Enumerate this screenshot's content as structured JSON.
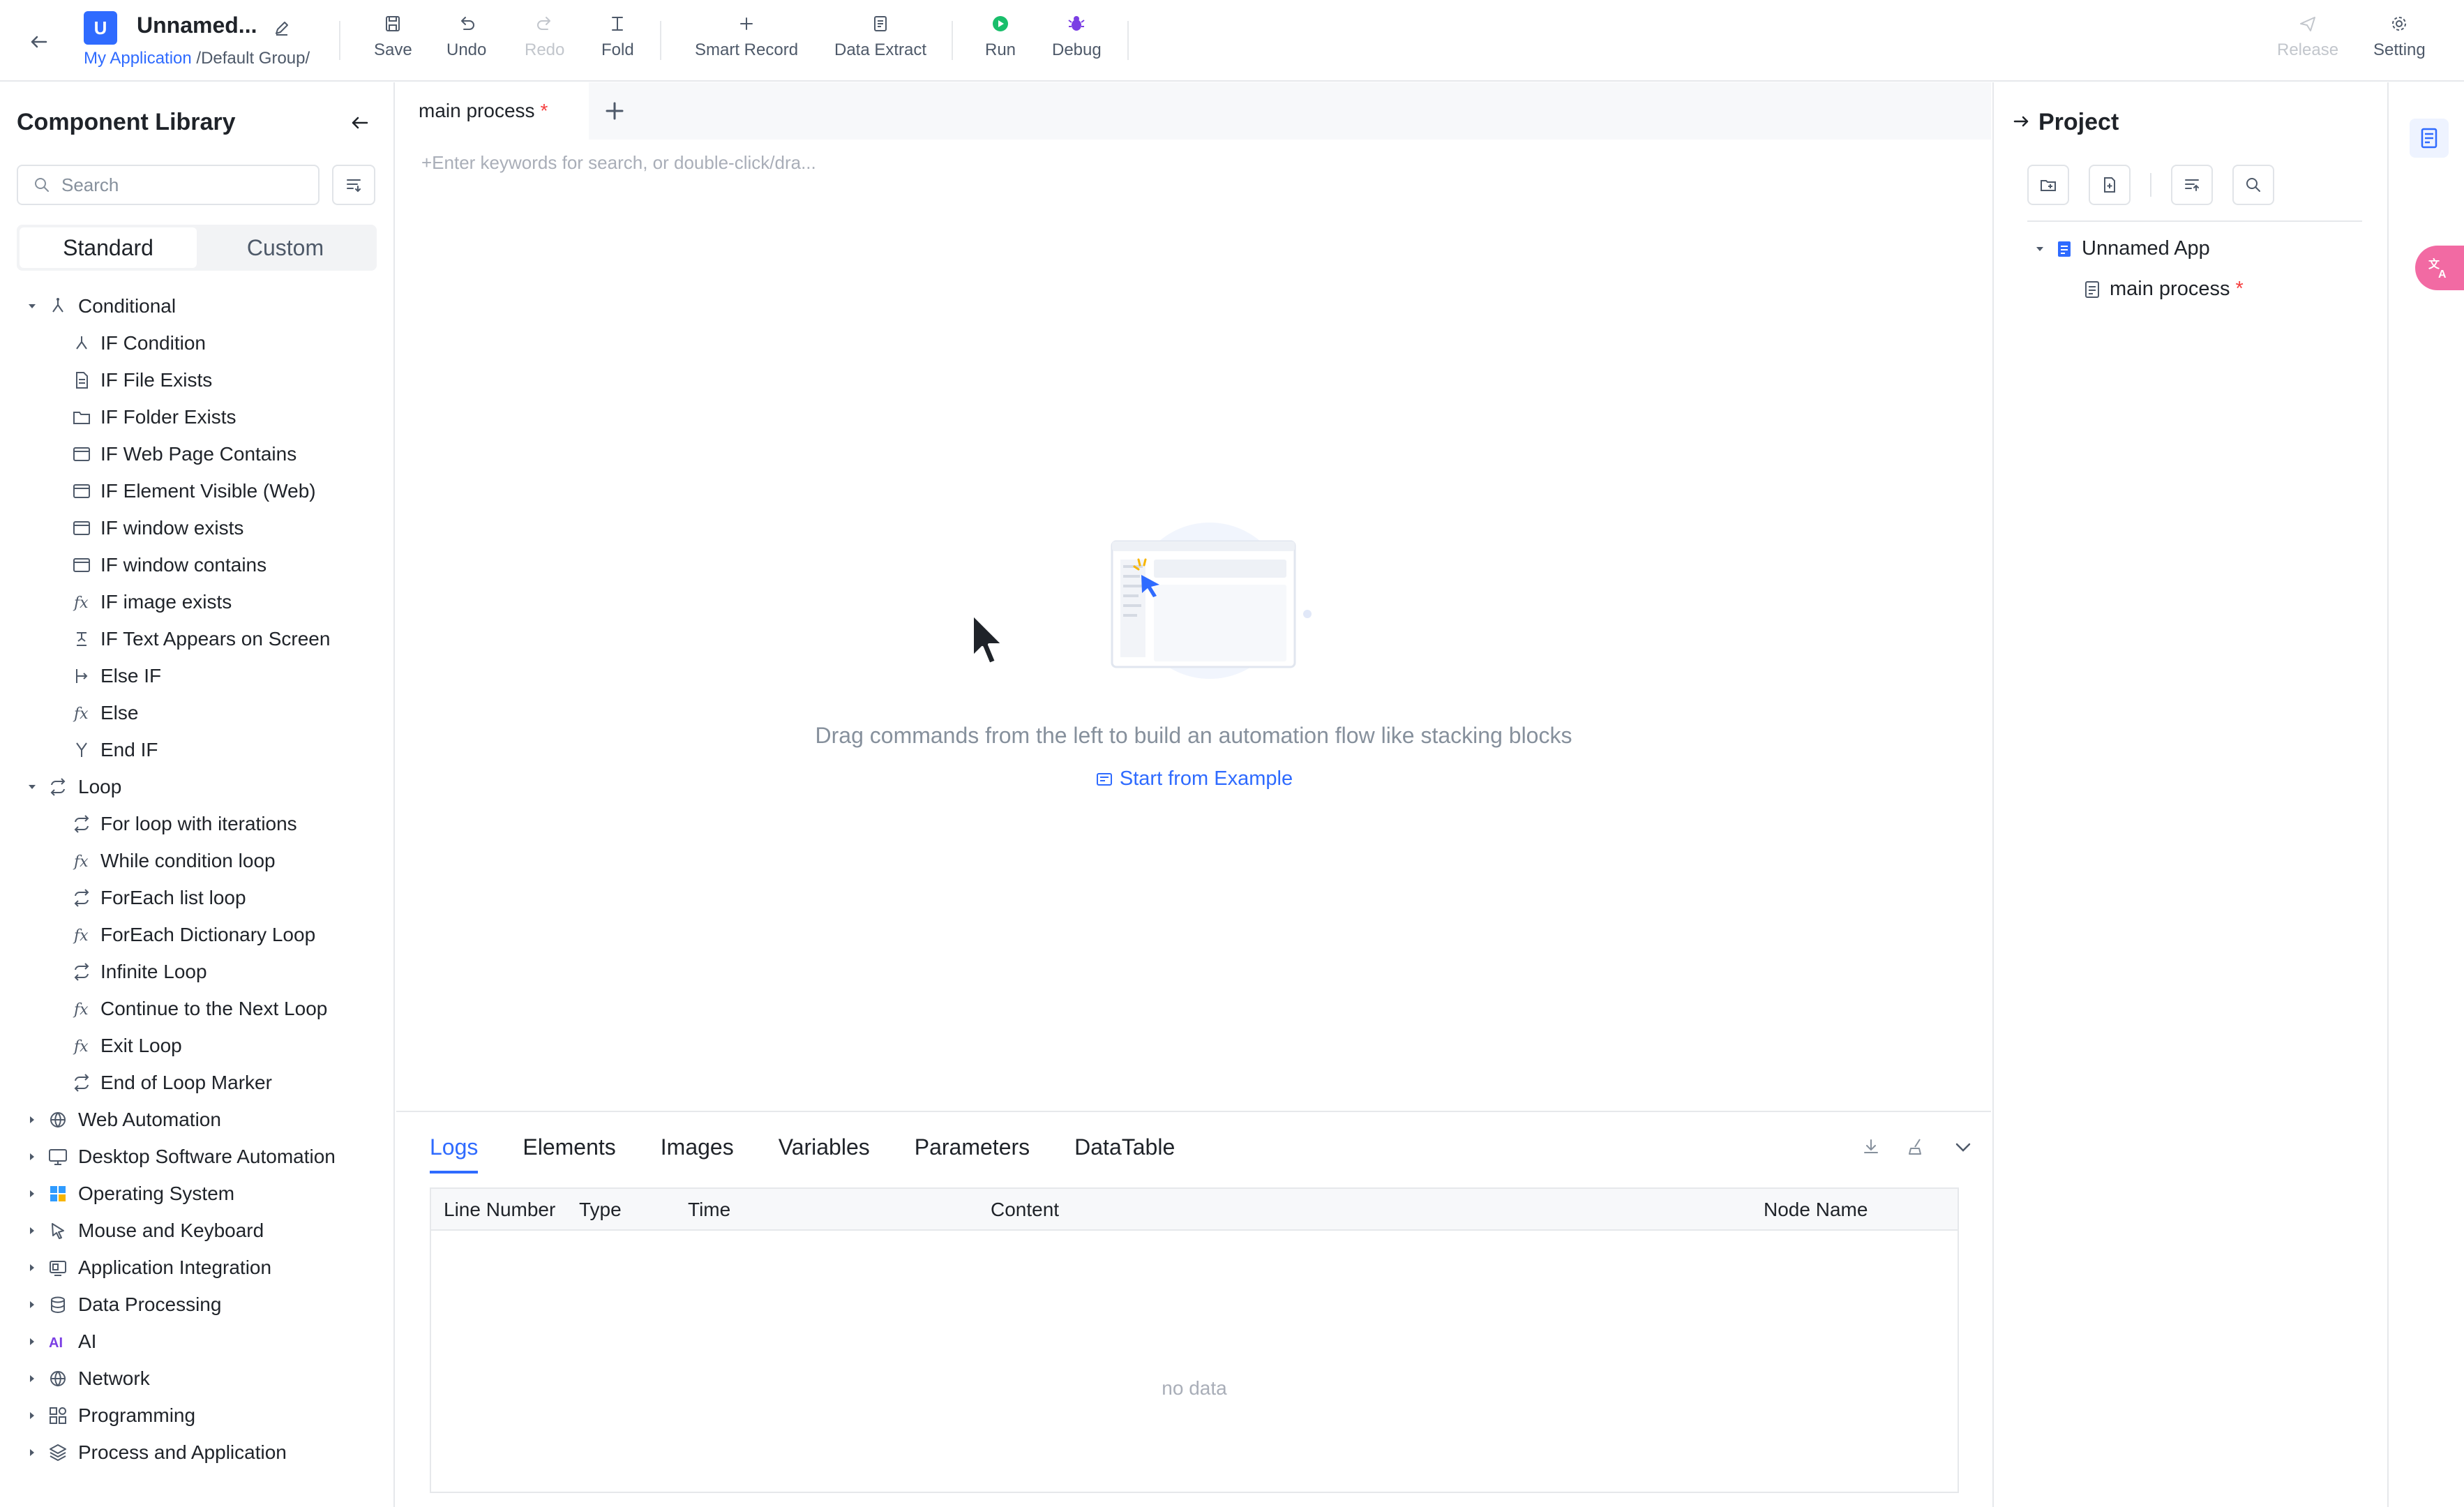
{
  "header": {
    "app_badge": "U",
    "app_name": "Unnamed...",
    "breadcrumb_link": "My Application",
    "breadcrumb_rest": " /Default Group/",
    "toolbar": {
      "save": "Save",
      "undo": "Undo",
      "redo": "Redo",
      "fold": "Fold",
      "smart_record": "Smart Record",
      "data_extract": "Data Extract",
      "run": "Run",
      "debug": "Debug",
      "release": "Release",
      "setting": "Setting"
    }
  },
  "left_panel": {
    "title": "Component Library",
    "search_placeholder": "Search",
    "tabs": [
      "Standard",
      "Custom"
    ],
    "conditional": {
      "label": "Conditional",
      "items": [
        "IF Condition",
        "IF File Exists",
        "IF Folder Exists",
        "IF Web Page Contains",
        "IF Element Visible (Web)",
        "IF window exists",
        "IF window contains",
        "IF image exists",
        "IF Text Appears on Screen",
        "Else IF",
        "Else",
        "End IF"
      ]
    },
    "loop": {
      "label": "Loop",
      "items": [
        "For loop with iterations",
        "While condition loop",
        "ForEach list loop",
        "ForEach Dictionary Loop",
        "Infinite Loop",
        "Continue to the Next Loop",
        "Exit Loop",
        "End of Loop Marker"
      ]
    },
    "categories": [
      "Web Automation",
      "Desktop Software Automation",
      "Operating System",
      "Mouse and Keyboard",
      "Application Integration",
      "Data Processing",
      "AI",
      "Network",
      "Programming",
      "Process and Application"
    ]
  },
  "editor": {
    "tab_label": "main process",
    "tab_modified": "*",
    "command_placeholder": "+Enter keywords for search, or double-click/dra...",
    "empty_text": "Drag commands from the left to build an automation flow like stacking blocks",
    "example_link": "Start from Example"
  },
  "bottom_panel": {
    "tabs": [
      "Logs",
      "Elements",
      "Images",
      "Variables",
      "Parameters",
      "DataTable"
    ],
    "columns": [
      "Line Number",
      "Type",
      "Time",
      "Content",
      "Node Name"
    ],
    "empty": "no data"
  },
  "right_panel": {
    "title": "Project",
    "root": "Unnamed App",
    "child": "main process",
    "child_modified": "*"
  },
  "colors": {
    "accent": "#2f6bff",
    "modified_star": "#f53f3f",
    "run_green": "#19be6b",
    "debug_purple": "#7b3fe4",
    "translate_pink": "#f26aa3"
  }
}
